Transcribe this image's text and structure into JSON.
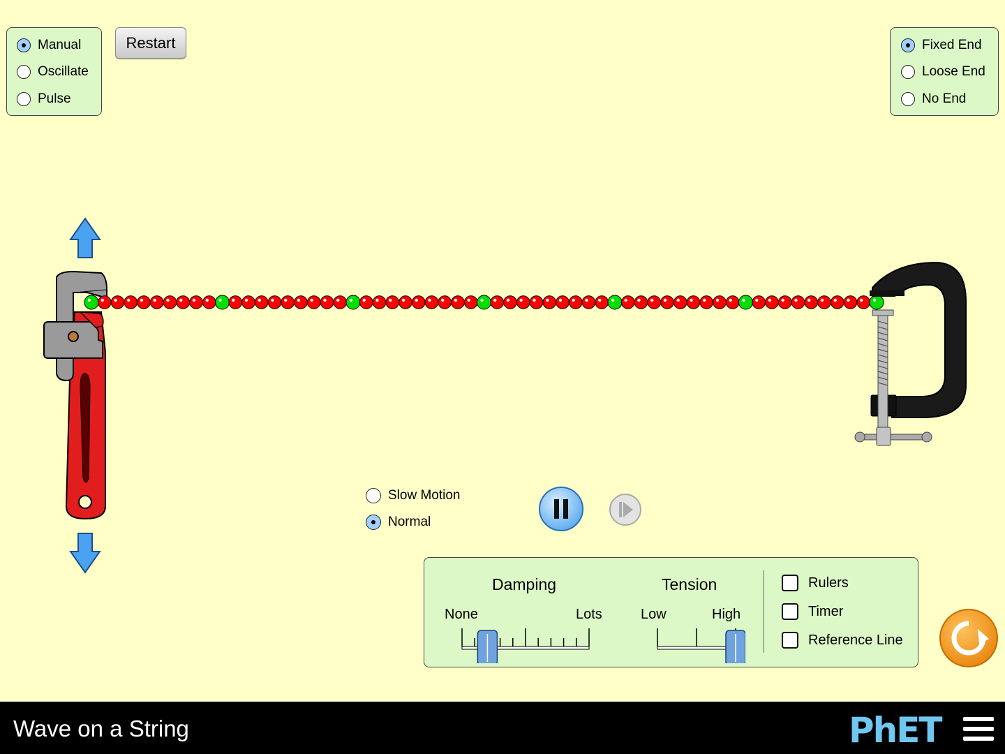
{
  "mode": {
    "options": [
      {
        "label": "Manual",
        "selected": true
      },
      {
        "label": "Oscillate",
        "selected": false
      },
      {
        "label": "Pulse",
        "selected": false
      }
    ]
  },
  "restart_label": "Restart",
  "end": {
    "options": [
      {
        "label": "Fixed End",
        "selected": true
      },
      {
        "label": "Loose End",
        "selected": false
      },
      {
        "label": "No End",
        "selected": false
      }
    ]
  },
  "speed": {
    "options": [
      {
        "label": "Slow Motion",
        "selected": false
      },
      {
        "label": "Normal",
        "selected": true
      }
    ]
  },
  "controls": {
    "damping": {
      "title": "Damping",
      "min_label": "None",
      "max_label": "Lots",
      "value": 0.2
    },
    "tension": {
      "title": "Tension",
      "min_label": "Low",
      "max_label": "High",
      "value": 1.0
    },
    "checkboxes": [
      {
        "label": "Rulers",
        "checked": false
      },
      {
        "label": "Timer",
        "checked": false
      },
      {
        "label": "Reference Line",
        "checked": false
      }
    ]
  },
  "string": {
    "bead_count": 61,
    "green_every": 10,
    "red": "#ff0000",
    "green": "#00e000"
  },
  "footer": {
    "title": "Wave on a String",
    "logo": "PhET"
  },
  "colors": {
    "background": "#ffffc8",
    "panel": "#dbf8c6",
    "accent_blue": "#4aa3f0",
    "reset_orange": "#f39b1e"
  },
  "icons": [
    "up-arrow-icon",
    "down-arrow-icon",
    "pause-icon",
    "step-icon",
    "reset-all-icon",
    "hamburger-menu-icon"
  ]
}
